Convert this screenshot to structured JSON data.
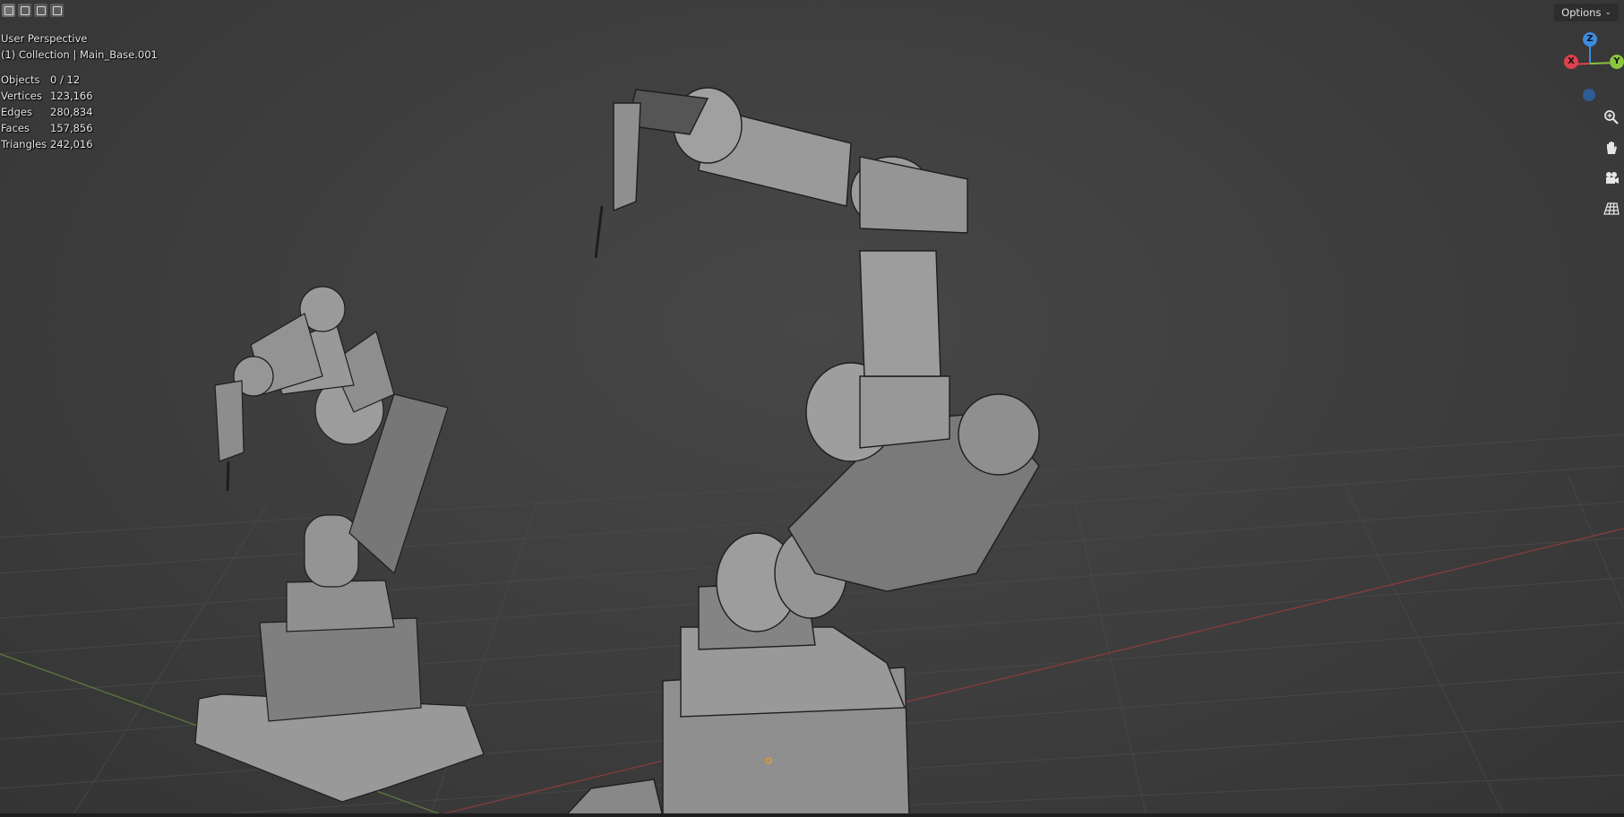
{
  "viewport": {
    "view_name": "User Perspective",
    "collection_info": "(1) Collection | Main_Base.001",
    "stats": [
      {
        "label": "Objects",
        "value": "0 / 12"
      },
      {
        "label": "Vertices",
        "value": "123,166"
      },
      {
        "label": "Edges",
        "value": "280,834"
      },
      {
        "label": "Faces",
        "value": "157,856"
      },
      {
        "label": "Triangles",
        "value": "242,016"
      }
    ]
  },
  "header": {
    "select_modes": [
      "select-new-icon",
      "select-extend-icon",
      "select-subtract-icon",
      "select-intersect-icon"
    ],
    "options_label": "Options"
  },
  "gizmo": {
    "z_label": "Z",
    "y_label": "Y",
    "x_label": "X",
    "colors": {
      "x": "#e0404e",
      "y": "#8bc53f",
      "z": "#3b8be0"
    }
  },
  "side_tools": [
    "zoom-icon",
    "hand-pan-icon",
    "camera-icon",
    "grid-ortho-icon"
  ]
}
